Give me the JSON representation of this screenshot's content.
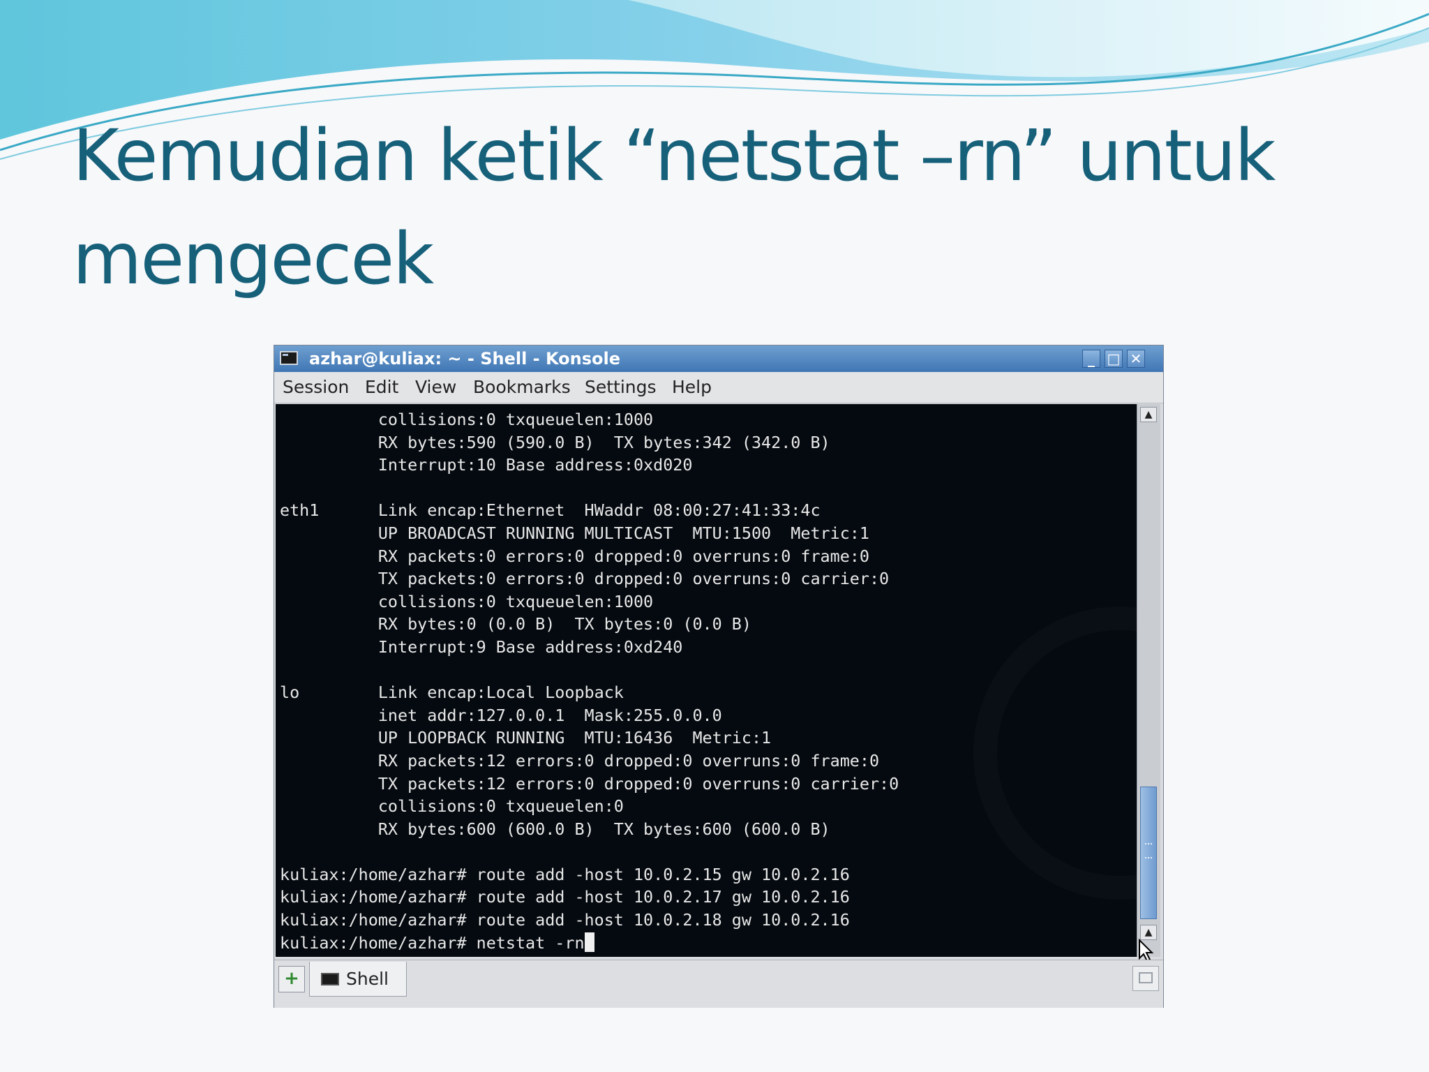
{
  "slide": {
    "title_line1": "Kemudian ketik “netstat –rn” untuk",
    "title_line2": "mengecek"
  },
  "window": {
    "title": "azhar@kuliax: ~ - Shell - Konsole",
    "controls": {
      "minimize": "_",
      "maximize": "□",
      "close": "✕"
    }
  },
  "menu": [
    "Session",
    "Edit",
    "View",
    "Bookmarks",
    "Settings",
    "Help"
  ],
  "terminal": {
    "lines": [
      "          collisions:0 txqueuelen:1000",
      "          RX bytes:590 (590.0 B)  TX bytes:342 (342.0 B)",
      "          Interrupt:10 Base address:0xd020",
      "",
      "eth1      Link encap:Ethernet  HWaddr 08:00:27:41:33:4c",
      "          UP BROADCAST RUNNING MULTICAST  MTU:1500  Metric:1",
      "          RX packets:0 errors:0 dropped:0 overruns:0 frame:0",
      "          TX packets:0 errors:0 dropped:0 overruns:0 carrier:0",
      "          collisions:0 txqueuelen:1000",
      "          RX bytes:0 (0.0 B)  TX bytes:0 (0.0 B)",
      "          Interrupt:9 Base address:0xd240",
      "",
      "lo        Link encap:Local Loopback",
      "          inet addr:127.0.0.1  Mask:255.0.0.0",
      "          UP LOOPBACK RUNNING  MTU:16436  Metric:1",
      "          RX packets:12 errors:0 dropped:0 overruns:0 frame:0",
      "          TX packets:12 errors:0 dropped:0 overruns:0 carrier:0",
      "          collisions:0 txqueuelen:0",
      "          RX bytes:600 (600.0 B)  TX bytes:600 (600.0 B)",
      "",
      "kuliax:/home/azhar# route add -host 10.0.2.15 gw 10.0.2.16",
      "kuliax:/home/azhar# route add -host 10.0.2.17 gw 10.0.2.16",
      "kuliax:/home/azhar# route add -host 10.0.2.18 gw 10.0.2.16",
      "kuliax:/home/azhar# netstat -rn"
    ]
  },
  "tabs": [
    {
      "label": "Shell",
      "icon": "terminal-icon"
    }
  ],
  "icons": {
    "new_tab": "new-tab-icon",
    "close_tab": "close-tab-icon"
  },
  "colors": {
    "title_text": "#16607a",
    "titlebar": "#4a80bd",
    "terminal_bg": "#050a10",
    "terminal_fg": "#e8e8e8"
  }
}
